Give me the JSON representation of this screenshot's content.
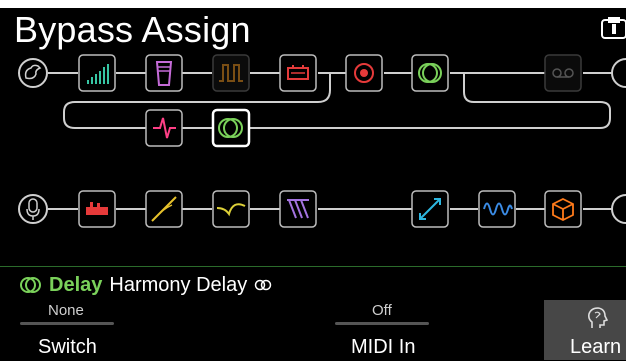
{
  "title": "Bypass Assign",
  "colors": {
    "selected_block": "#7ad15a",
    "accent_green": "#4caf50"
  },
  "path_a": {
    "input_icon": "guitar-input-icon",
    "blocks": [
      {
        "name": "eq-graphic-icon",
        "color": "#37c6a4"
      },
      {
        "name": "wah-pedal-icon",
        "color": "#c56bd8"
      },
      {
        "name": "gate-icon",
        "color": "#b9731c",
        "dim": true
      },
      {
        "name": "amp-icon",
        "color": "#e43b3b"
      },
      {
        "name": "cab-speaker-icon",
        "color": "#e63a3a"
      },
      {
        "name": "delay-icon",
        "color": "#7ad15a"
      },
      {
        "name": "looper-icon",
        "color": "#8a8a8a",
        "dim": true
      }
    ],
    "branch_blocks": [
      {
        "name": "dynamics-icon",
        "color": "#ff3f86"
      },
      {
        "name": "delay-icon",
        "color": "#7ad15a",
        "selected": true
      }
    ]
  },
  "path_b": {
    "input_icon": "microphone-input-icon",
    "blocks": [
      {
        "name": "distortion-pedal-icon",
        "color": "#e63a3a"
      },
      {
        "name": "pitch-icon",
        "color": "#e6c12b"
      },
      {
        "name": "filter-icon",
        "color": "#ddd038"
      },
      {
        "name": "modulation-icon",
        "color": "#a473e0"
      },
      {
        "name": "split-icon",
        "color": "#2db7e0"
      },
      {
        "name": "reverb-wave-icon",
        "color": "#3b8ce6"
      },
      {
        "name": "cube-fx-icon",
        "color": "#ff7a1a"
      }
    ]
  },
  "selected_block": {
    "category": "Delay",
    "model": "Harmony Delay",
    "icon": "delay-icon",
    "stereo_icon": "stereo-link-icon"
  },
  "params": [
    {
      "label": "Switch",
      "value": "None",
      "level": 0
    },
    {
      "label": "MIDI In",
      "value": "Off",
      "level": 0
    }
  ],
  "learn": {
    "label": "Learn",
    "icon": "learn-head-icon"
  }
}
